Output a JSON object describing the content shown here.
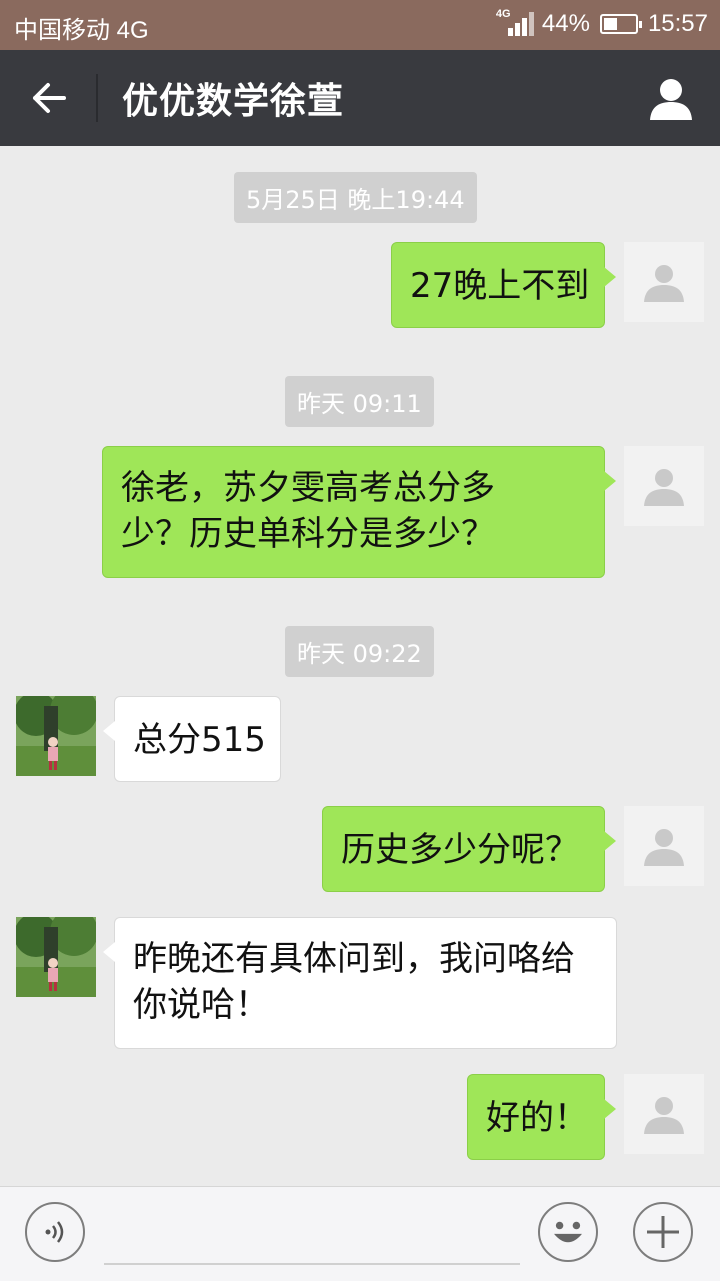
{
  "status_bar": {
    "carrier": "中国移动 4G",
    "network_tag": "4G",
    "battery": "44%",
    "battery_level": 0.44,
    "time": "15:57"
  },
  "header": {
    "title": "优优数学徐萱",
    "back_icon": "back-arrow-icon",
    "profile_icon": "person-icon"
  },
  "messages": [
    {
      "type": "time",
      "text": "5月25日 晚上19:44"
    },
    {
      "type": "me",
      "text": "27晚上不到"
    },
    {
      "type": "time",
      "text": "昨天 09:11"
    },
    {
      "type": "me",
      "lines": [
        "徐老，苏夕雯高考总分多",
        "少？历史单科分是多少？"
      ]
    },
    {
      "type": "time",
      "text": "昨天 09:22"
    },
    {
      "type": "other",
      "text": "总分515"
    },
    {
      "type": "me",
      "text": "历史多少分呢？"
    },
    {
      "type": "other",
      "lines": [
        "昨晚还有具体问到，我问咯给",
        "你说哈！"
      ]
    },
    {
      "type": "me",
      "text": "好的！"
    }
  ],
  "bottom_bar": {
    "voice_icon": "voice-icon",
    "emoji_icon": "emoji-icon",
    "add_icon": "plus-icon"
  },
  "colors": {
    "status_bar": "#8a6a5e",
    "title_bar": "#393a3f",
    "background": "#ebebeb",
    "my_bubble": "#9fe658",
    "other_bubble": "#ffffff"
  }
}
